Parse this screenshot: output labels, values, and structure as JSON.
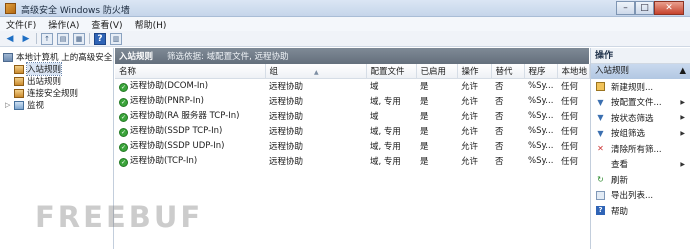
{
  "window": {
    "title": "高级安全 Windows 防火墙",
    "min_label": "–",
    "max_label": "□",
    "close_label": "✕"
  },
  "menu": [
    "文件(F)",
    "操作(A)",
    "查看(V)",
    "帮助(H)"
  ],
  "tree": {
    "root": "本地计算机 上的高级安全",
    "items": [
      "入站规则",
      "出站规则",
      "连接安全规则",
      "监视"
    ]
  },
  "center": {
    "header_title": "入站规则",
    "header_filter": "筛选依据: 域配置文件, 远程协助",
    "columns": [
      "名称",
      "组",
      "配置文件",
      "已启用",
      "操作",
      "替代",
      "程序",
      "本地地"
    ],
    "rows": [
      [
        "远程协助(DCOM-In)",
        "远程协助",
        "域",
        "是",
        "允许",
        "否",
        "%Sy...",
        "任何"
      ],
      [
        "远程协助(PNRP-In)",
        "远程协助",
        "域, 专用",
        "是",
        "允许",
        "否",
        "%Sy...",
        "任何"
      ],
      [
        "远程协助(RA 服务器 TCP-In)",
        "远程协助",
        "域",
        "是",
        "允许",
        "否",
        "%Sy...",
        "任何"
      ],
      [
        "远程协助(SSDP TCP-In)",
        "远程协助",
        "域, 专用",
        "是",
        "允许",
        "否",
        "%Sy...",
        "任何"
      ],
      [
        "远程协助(SSDP UDP-In)",
        "远程协助",
        "域, 专用",
        "是",
        "允许",
        "否",
        "%Sy...",
        "任何"
      ],
      [
        "远程协助(TCP-In)",
        "远程协助",
        "域, 专用",
        "是",
        "允许",
        "否",
        "%Sy...",
        "任何"
      ]
    ]
  },
  "actions": {
    "header": "操作",
    "section": "入站规则",
    "items": [
      "新建规则...",
      "按配置文件...",
      "按状态筛选",
      "按组筛选",
      "清除所有筛...",
      "查看",
      "刷新",
      "导出列表...",
      "帮助"
    ]
  },
  "watermark": "FREEBUF"
}
